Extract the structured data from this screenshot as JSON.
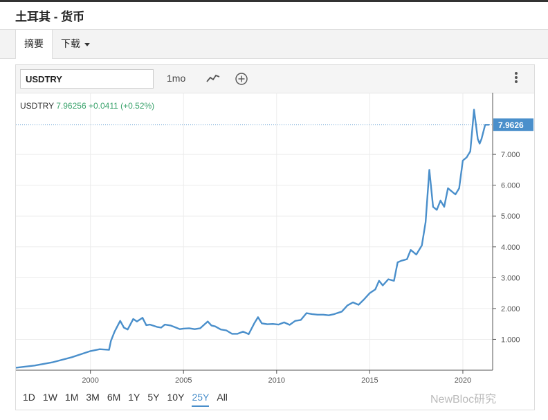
{
  "page": {
    "title": "土耳其 - 货币",
    "tabs": [
      "摘要",
      "下载"
    ]
  },
  "toolbar": {
    "symbol_value": "USDTRY",
    "interval": "1mo",
    "icons": [
      "line-chart-icon",
      "add-circle-icon",
      "more-vertical-icon"
    ]
  },
  "quote": {
    "symbol": "USDTRY",
    "price": "7.96256",
    "change": "+0.0411",
    "change_pct": "(+0.52%)"
  },
  "ranges": [
    "1D",
    "1W",
    "1M",
    "3M",
    "6M",
    "1Y",
    "5Y",
    "10Y",
    "25Y",
    "All"
  ],
  "active_range": "25Y",
  "watermark": "NewBloc研究",
  "colors": {
    "line": "#4a8fcb",
    "last_price_tag": "#4a8fcb",
    "change_text": "#3aa36c",
    "grid": "#ececec"
  },
  "chart_data": {
    "type": "line",
    "series": [
      {
        "x": [
          1996.0,
          1997.0,
          1998.0,
          1999.0,
          2000.0,
          2000.5,
          2001.0,
          2001.1,
          2001.3,
          2001.6,
          2001.8,
          2002.0,
          2002.3,
          2002.5,
          2002.8,
          2003.0,
          2003.2,
          2003.6,
          2003.8,
          2004.0,
          2004.3,
          2004.6,
          2004.8,
          2005.0,
          2005.3,
          2005.6,
          2005.9,
          2006.3,
          2006.5,
          2006.7,
          2007.0,
          2007.3,
          2007.6,
          2007.9,
          2008.2,
          2008.5,
          2008.8,
          2009.0,
          2009.2,
          2009.5,
          2009.8,
          2010.1,
          2010.4,
          2010.7,
          2011.0,
          2011.3,
          2011.6,
          2011.9,
          2012.2,
          2012.5,
          2012.8,
          2013.1,
          2013.5,
          2013.8,
          2014.1,
          2014.4,
          2014.7,
          2015.0,
          2015.3,
          2015.5,
          2015.7,
          2016.0,
          2016.3,
          2016.5,
          2016.7,
          2017.0,
          2017.2,
          2017.5,
          2017.8,
          2018.0,
          2018.2,
          2018.4,
          2018.6,
          2018.8,
          2019.0,
          2019.2,
          2019.4,
          2019.6,
          2019.8,
          2020.0,
          2020.2,
          2020.4,
          2020.6,
          2020.8,
          2020.9,
          2021.0,
          2021.2,
          2021.4
        ],
        "y": [
          0.08,
          0.15,
          0.26,
          0.42,
          0.62,
          0.68,
          0.66,
          0.95,
          1.25,
          1.6,
          1.38,
          1.32,
          1.66,
          1.58,
          1.7,
          1.46,
          1.48,
          1.4,
          1.38,
          1.48,
          1.45,
          1.38,
          1.33,
          1.35,
          1.36,
          1.33,
          1.36,
          1.58,
          1.45,
          1.42,
          1.32,
          1.29,
          1.18,
          1.18,
          1.25,
          1.17,
          1.52,
          1.72,
          1.52,
          1.49,
          1.5,
          1.48,
          1.55,
          1.47,
          1.6,
          1.63,
          1.85,
          1.82,
          1.8,
          1.8,
          1.78,
          1.82,
          1.9,
          2.1,
          2.2,
          2.12,
          2.3,
          2.5,
          2.62,
          2.9,
          2.75,
          2.95,
          2.9,
          3.5,
          3.55,
          3.6,
          3.9,
          3.75,
          4.05,
          4.8,
          6.5,
          5.3,
          5.2,
          5.5,
          5.3,
          5.9,
          5.8,
          5.7,
          5.9,
          6.8,
          6.9,
          7.1,
          8.45,
          7.5,
          7.35,
          7.5,
          7.96,
          7.96
        ]
      }
    ],
    "xlim": [
      1996.0,
      2021.6
    ],
    "ylim": [
      0.0,
      9.0
    ],
    "x_ticks": [
      2000,
      2005,
      2010,
      2015,
      2020
    ],
    "y_ticks": [
      1,
      2,
      3,
      4,
      5,
      6,
      7
    ],
    "y_tick_labels": [
      "1.000",
      "2.000",
      "3.000",
      "4.000",
      "5.000",
      "6.000",
      "7.000"
    ],
    "last_value": 7.9626,
    "last_value_label": "7.9626",
    "grid": true,
    "reference_line": "dotted line at last value",
    "xlabel": "",
    "ylabel": ""
  }
}
